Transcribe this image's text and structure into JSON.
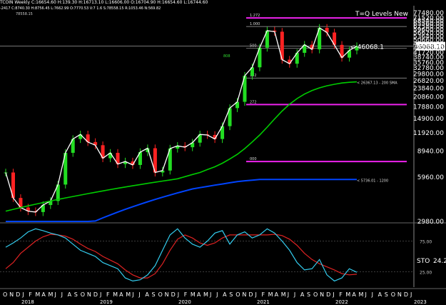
{
  "header": {
    "symbol_line": "TCOIN Weekly C:16654.60 H:139.30 H:16713.10 L:16606.00 O:16704.90 H:16654.60 L:16744.60",
    "indicator_line": "-2417 C:8740.30 H:8756.45 L:7662.99 O:7770.53 V:7 1.6 S:78558.15 R:1053.46 N:569.82",
    "sub_value": "78558.15",
    "title": "T=Q Levels New"
  },
  "colors": {
    "background": "#000000",
    "candle_up": "#22dd22",
    "candle_down": "#ff2222",
    "sma_200": "#00cc00",
    "sma_1200": "#0044ff",
    "fib_magenta": "#ee22ee",
    "stoch_k": "#33ccee",
    "stoch_d": "#dd2222"
  },
  "annotations": {
    "current_price_label": "< 46068.1",
    "current_price_box": "46068.10",
    "sma200_label": "< 26367.13 - 200 SMA",
    "sma1200_label": "< 5736.01 - 1200",
    "fib_labels": [
      "1.272",
      "1.000",
      "500",
      "382",
      "272",
      "000"
    ],
    "green_note": "808",
    "stoch_label": "STO",
    "stoch_value": "24.2",
    "stoch_levels": [
      "25.00",
      "75.00"
    ]
  },
  "chart_data": {
    "type": "candlestick",
    "title": "T=Q Levels New",
    "y_scale": "log",
    "ylim": [
      2980,
      77480
    ],
    "y_ticks": [
      "77480.00",
      "71520.00",
      "68540.00",
      "65560.00",
      "62580.00",
      "59600.00",
      "56620.00",
      "53640.00",
      "50660.00",
      "47680.00",
      "44700.00",
      "41720.00",
      "38740.00",
      "35760.00",
      "32780.00",
      "29800.00",
      "26820.00",
      "23840.00",
      "20860.00",
      "17880.00",
      "14900.00",
      "11920.00",
      "8940.00",
      "5960.00",
      "2980.00"
    ],
    "x_months": [
      "O",
      "N",
      "D",
      "J",
      "F",
      "M",
      "A",
      "M",
      "J",
      "J",
      "A",
      "S",
      "O",
      "N",
      "D",
      "J",
      "F",
      "M",
      "A",
      "M",
      "J",
      "J",
      "A",
      "S",
      "O",
      "N",
      "D",
      "J",
      "F",
      "M",
      "A",
      "M",
      "J",
      "J",
      "A",
      "S",
      "O",
      "N",
      "D",
      "J",
      "F",
      "M",
      "A",
      "M",
      "J",
      "J",
      "A",
      "S",
      "O",
      "N",
      "D",
      "J",
      "F",
      "M",
      "A",
      "M",
      "J",
      "J",
      "A",
      "S",
      "O",
      "N",
      "D",
      "J"
    ],
    "x_years": [
      "2018",
      "2019",
      "2020",
      "2021",
      "2022",
      "2023"
    ],
    "price_closes": [
      6400,
      4300,
      3700,
      3500,
      3450,
      3850,
      4100,
      5300,
      8700,
      10800,
      11600,
      10300,
      9800,
      8000,
      8700,
      7300,
      7600,
      7200,
      8800,
      9350,
      6400,
      6600,
      9300,
      9700,
      9500,
      10200,
      11600,
      11500,
      10800,
      13200,
      17500,
      19300,
      29000,
      33100,
      45000,
      58700,
      57700,
      37300,
      35000,
      41500,
      47100,
      43800,
      61300,
      57000,
      47000,
      38500,
      43100,
      46068
    ],
    "sma200": [
      3500,
      3600,
      3700,
      3800,
      3900,
      4000,
      4100,
      4200,
      4300,
      4400,
      4500,
      4600,
      4700,
      4800,
      4900,
      5000,
      5100,
      5200,
      5300,
      5400,
      5500,
      5600,
      5700,
      5800,
      6000,
      6200,
      6400,
      6700,
      7000,
      7400,
      7900,
      8500,
      9300,
      10300,
      11500,
      13000,
      14800,
      16700,
      18600,
      20300,
      21800,
      23000,
      24000,
      24800,
      25400,
      25900,
      26200,
      26367
    ],
    "sma1200": [
      1200,
      1350,
      1500,
      1650,
      1800,
      1950,
      2100,
      2250,
      2400,
      2550,
      2700,
      2850,
      3000,
      3150,
      3300,
      3450,
      3600,
      3750,
      3900,
      4050,
      4200,
      4350,
      4500,
      4650,
      4800,
      4950,
      5050,
      5150,
      5250,
      5350,
      5450,
      5550,
      5620,
      5680,
      5736,
      5736,
      5736,
      5736,
      5736,
      5736,
      5736,
      5736,
      5736,
      5736,
      5736,
      5736,
      5736,
      5736
    ],
    "fib_levels": [
      {
        "label": "1.272",
        "value": 71520
      },
      {
        "label": "1.000",
        "value": 62580
      },
      {
        "label": "500",
        "value": 44700
      },
      {
        "label": "382",
        "value": 28000
      },
      {
        "label": "272",
        "value": 18500
      },
      {
        "label": "000",
        "value": 7600
      }
    ],
    "stochastic": {
      "levels": [
        25,
        75
      ],
      "k": [
        65,
        72,
        80,
        90,
        95,
        92,
        88,
        85,
        80,
        70,
        60,
        55,
        50,
        40,
        35,
        30,
        15,
        10,
        12,
        20,
        35,
        60,
        85,
        95,
        80,
        70,
        65,
        75,
        88,
        92,
        70,
        85,
        90,
        80,
        85,
        95,
        88,
        75,
        60,
        40,
        28,
        30,
        45,
        20,
        10,
        15,
        30,
        24.2
      ],
      "d": [
        30,
        40,
        55,
        65,
        75,
        82,
        86,
        85,
        83,
        78,
        70,
        63,
        58,
        50,
        44,
        38,
        28,
        20,
        15,
        15,
        22,
        38,
        60,
        78,
        85,
        80,
        72,
        68,
        72,
        80,
        85,
        85,
        85,
        85,
        85,
        85,
        86,
        84,
        78,
        68,
        55,
        45,
        38,
        33,
        28,
        22,
        20,
        21
      ]
    }
  }
}
